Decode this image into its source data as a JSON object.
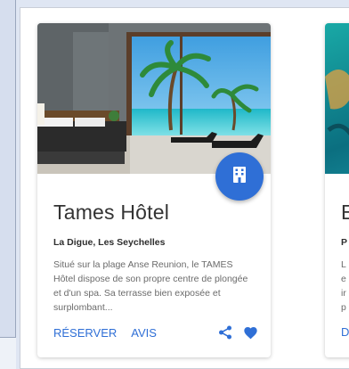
{
  "cards": [
    {
      "title": "Tames Hôtel",
      "location": "La Digue, Les Seychelles",
      "description": "Situé sur la plage Anse Reunion, le TAMES Hôtel dispose de son propre centre de plongée et d'un spa. Sa terrasse bien exposée et surplombant...",
      "actions": [
        "RÉSERVER",
        "AVIS"
      ],
      "icons": [
        "hotel-icon",
        "share-icon",
        "heart-icon"
      ],
      "colors": {
        "accent": "#2f6fd6"
      }
    },
    {
      "title": "E",
      "location": "P",
      "description_lines": [
        "L",
        "e",
        "ir",
        "p"
      ],
      "actions": [
        "D"
      ]
    }
  ]
}
